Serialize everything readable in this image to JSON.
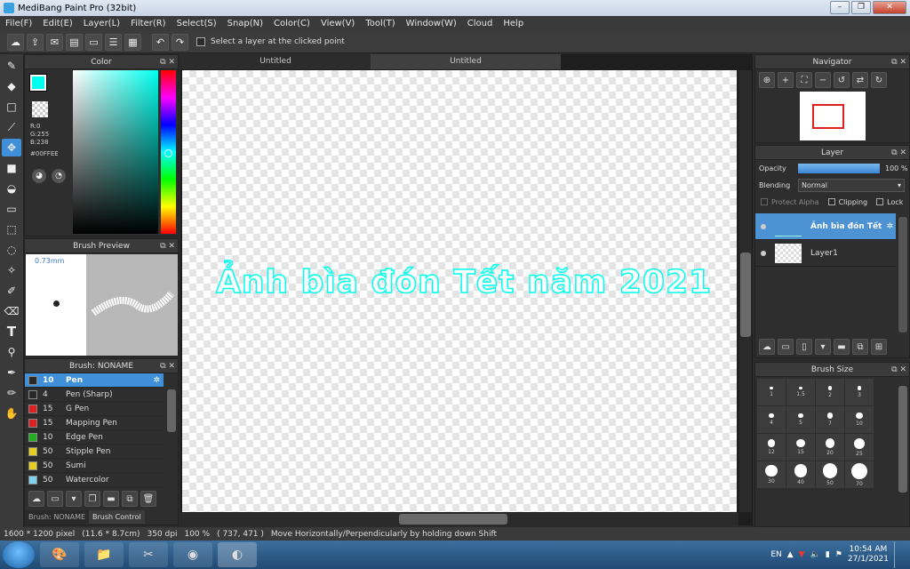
{
  "window": {
    "title": "MediBang Paint Pro (32bit)"
  },
  "menu": [
    "File(F)",
    "Edit(E)",
    "Layer(L)",
    "Filter(R)",
    "Select(S)",
    "Snap(N)",
    "Color(C)",
    "View(V)",
    "Tool(T)",
    "Window(W)",
    "Cloud",
    "Help"
  ],
  "toolbar": {
    "select_layer_label": "Select a layer at the clicked point"
  },
  "color_panel": {
    "title": "Color",
    "r": "R:0",
    "g": "G:255",
    "b": "B:238",
    "hex": "#00FFEE",
    "fg": "#00ffee"
  },
  "brush_preview": {
    "title": "Brush Preview",
    "size": "0.73mm"
  },
  "brush_panel": {
    "title": "Brush: NONAME",
    "items": [
      {
        "size": "10",
        "name": "Pen",
        "color": "#2a2a2a"
      },
      {
        "size": "4",
        "name": "Pen (Sharp)",
        "color": "#2a2a2a"
      },
      {
        "size": "15",
        "name": "G Pen",
        "color": "#e02020"
      },
      {
        "size": "15",
        "name": "Mapping Pen",
        "color": "#e02020"
      },
      {
        "size": "10",
        "name": "Edge Pen",
        "color": "#20b020"
      },
      {
        "size": "50",
        "name": "Stipple Pen",
        "color": "#e8d020"
      },
      {
        "size": "50",
        "name": "Sumi",
        "color": "#e8d020"
      },
      {
        "size": "50",
        "name": "Watercolor",
        "color": "#80d0f0"
      }
    ],
    "tab1": "Brush: NONAME",
    "tab2": "Brush Control"
  },
  "doc_tabs": [
    "Untitled",
    "Untitled"
  ],
  "canvas": {
    "text": "Ảnh bìa đón Tết năm 2021"
  },
  "navigator": {
    "title": "Navigator"
  },
  "layer_panel": {
    "title": "Layer",
    "opacity_label": "Opacity",
    "opacity_value": "100 %",
    "opacity": 1.0,
    "blending_label": "Blending",
    "blending_value": "Normal",
    "protect_alpha": "Protect Alpha",
    "clipping": "Clipping",
    "lock": "Lock",
    "layers": [
      "Ảnh bìa đón Tết",
      "Layer1"
    ]
  },
  "brush_size": {
    "title": "Brush Size",
    "sizes": [
      "1",
      "1.5",
      "2",
      "3",
      "4",
      "5",
      "7",
      "10",
      "12",
      "15",
      "20",
      "25",
      "30",
      "40",
      "50",
      "70"
    ]
  },
  "status": {
    "dims": "1600 * 1200 pixel",
    "cm": "(11.6 * 8.7cm)",
    "dpi": "350 dpi",
    "zoom": "100 %",
    "coords": "( 737, 471 )",
    "hint": "Move Horizontally/Perpendicularly by holding down Shift"
  },
  "taskbar": {
    "lang": "EN",
    "time": "10:54 AM",
    "date": "27/1/2021"
  }
}
